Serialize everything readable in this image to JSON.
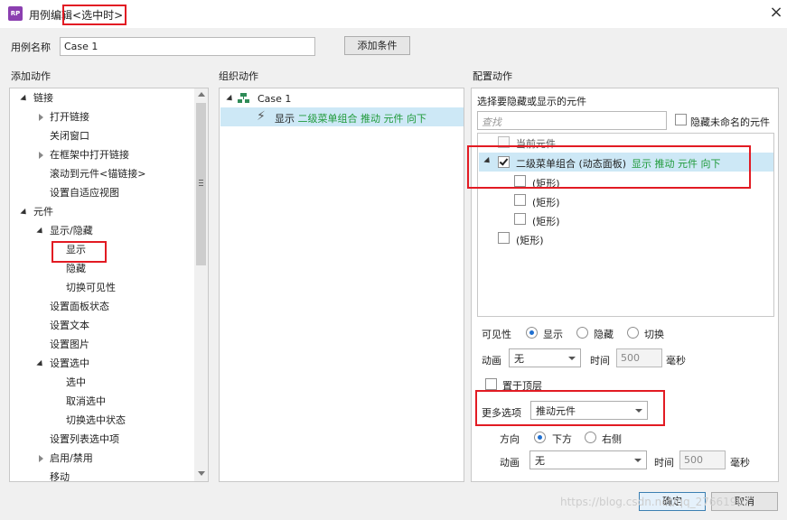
{
  "window": {
    "title_prefix": "用例编辑",
    "title_highlight": "<选中时>",
    "app_icon_text": "RP",
    "close_glyph": "×"
  },
  "case_name": {
    "label": "用例名称",
    "value": "Case 1",
    "add_condition_button": "添加条件"
  },
  "add_action": {
    "heading": "添加动作",
    "items": [
      {
        "label": "链接",
        "level": 0,
        "state": "open"
      },
      {
        "label": "打开链接",
        "level": 1,
        "state": "closed"
      },
      {
        "label": "关闭窗口",
        "level": 1,
        "state": "leaf"
      },
      {
        "label": "在框架中打开链接",
        "level": 1,
        "state": "closed"
      },
      {
        "label": "滚动到元件<锚链接>",
        "level": 1,
        "state": "leaf"
      },
      {
        "label": "设置自适应视图",
        "level": 1,
        "state": "leaf"
      },
      {
        "label": "元件",
        "level": 0,
        "state": "open"
      },
      {
        "label": "显示/隐藏",
        "level": 1,
        "state": "open"
      },
      {
        "label": "显示",
        "level": 2,
        "state": "leaf",
        "highlight": true
      },
      {
        "label": "隐藏",
        "level": 2,
        "state": "leaf"
      },
      {
        "label": "切换可见性",
        "level": 2,
        "state": "leaf"
      },
      {
        "label": "设置面板状态",
        "level": 1,
        "state": "leaf"
      },
      {
        "label": "设置文本",
        "level": 1,
        "state": "leaf"
      },
      {
        "label": "设置图片",
        "level": 1,
        "state": "leaf"
      },
      {
        "label": "设置选中",
        "level": 1,
        "state": "open"
      },
      {
        "label": "选中",
        "level": 2,
        "state": "leaf"
      },
      {
        "label": "取消选中",
        "level": 2,
        "state": "leaf"
      },
      {
        "label": "切换选中状态",
        "level": 2,
        "state": "leaf"
      },
      {
        "label": "设置列表选中项",
        "level": 1,
        "state": "leaf"
      },
      {
        "label": "启用/禁用",
        "level": 1,
        "state": "closed"
      },
      {
        "label": "移动",
        "level": 1,
        "state": "leaf"
      }
    ]
  },
  "organize_action": {
    "heading": "组织动作",
    "case_label": "Case 1",
    "action_prefix": "显示",
    "action_detail": "二级菜单组合 推动 元件 向下"
  },
  "configure_action": {
    "heading": "配置动作",
    "subheading": "选择要隐藏或显示的元件",
    "search_placeholder": "查找",
    "hide_unnamed_label": "隐藏未命名的元件",
    "tree": [
      {
        "label": "当前元件",
        "checked": false,
        "level": 0
      },
      {
        "label": "二级菜单组合 (动态面板)",
        "detail": "显示 推动 元件 向下",
        "checked": true,
        "level": 0,
        "expanded": true,
        "selected": true
      },
      {
        "label": "(矩形)",
        "checked": false,
        "level": 1
      },
      {
        "label": "(矩形)",
        "checked": false,
        "level": 1
      },
      {
        "label": "(矩形)",
        "checked": false,
        "level": 1
      },
      {
        "label": "(矩形)",
        "checked": false,
        "level": 0
      }
    ],
    "visibility_label": "可见性",
    "visibility_options": [
      "显示",
      "隐藏",
      "切换"
    ],
    "visibility_selected": "显示",
    "animation_label": "动画",
    "animation_value": "无",
    "time_label": "时间",
    "time_value": "500",
    "ms_label": "毫秒",
    "bring_to_front_label": "置于顶层",
    "more_options_label": "更多选项",
    "more_options_value": "推动元件",
    "direction_label": "方向",
    "direction_options": [
      "下方",
      "右侧"
    ],
    "direction_selected": "下方",
    "animation2_label": "动画",
    "animation2_value": "无",
    "time2_label": "时间",
    "time2_value": "500",
    "ms2_label": "毫秒"
  },
  "footer": {
    "ok_button": "确定",
    "cancel_button": "取消",
    "watermark": "https://blog.csdn.net/qq_27661907"
  },
  "colors": {
    "highlight_red": "#e21b23",
    "selection_blue": "#cde8f6",
    "action_green": "#1f9a3a",
    "accent_purple": "#8b3fb0"
  }
}
